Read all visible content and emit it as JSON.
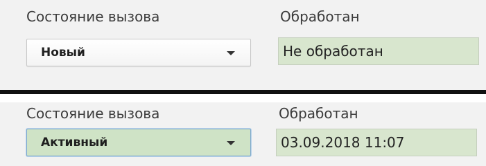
{
  "top": {
    "status_label": "Состояние вызова",
    "status_value": "Новый",
    "processed_label": "Обработан",
    "processed_value": "Не обработан"
  },
  "bottom": {
    "status_label": "Состояние вызова",
    "status_value": "Активный",
    "processed_label": "Обработан",
    "processed_value": "03.09.2018 11:07"
  },
  "colors": {
    "field_fill": "#d8e6ce",
    "active_select_fill": "#cfe3c6",
    "active_select_border": "#7fa9cf",
    "divider": "#111111"
  },
  "icons": {
    "dropdown": "chevron-down-icon"
  }
}
